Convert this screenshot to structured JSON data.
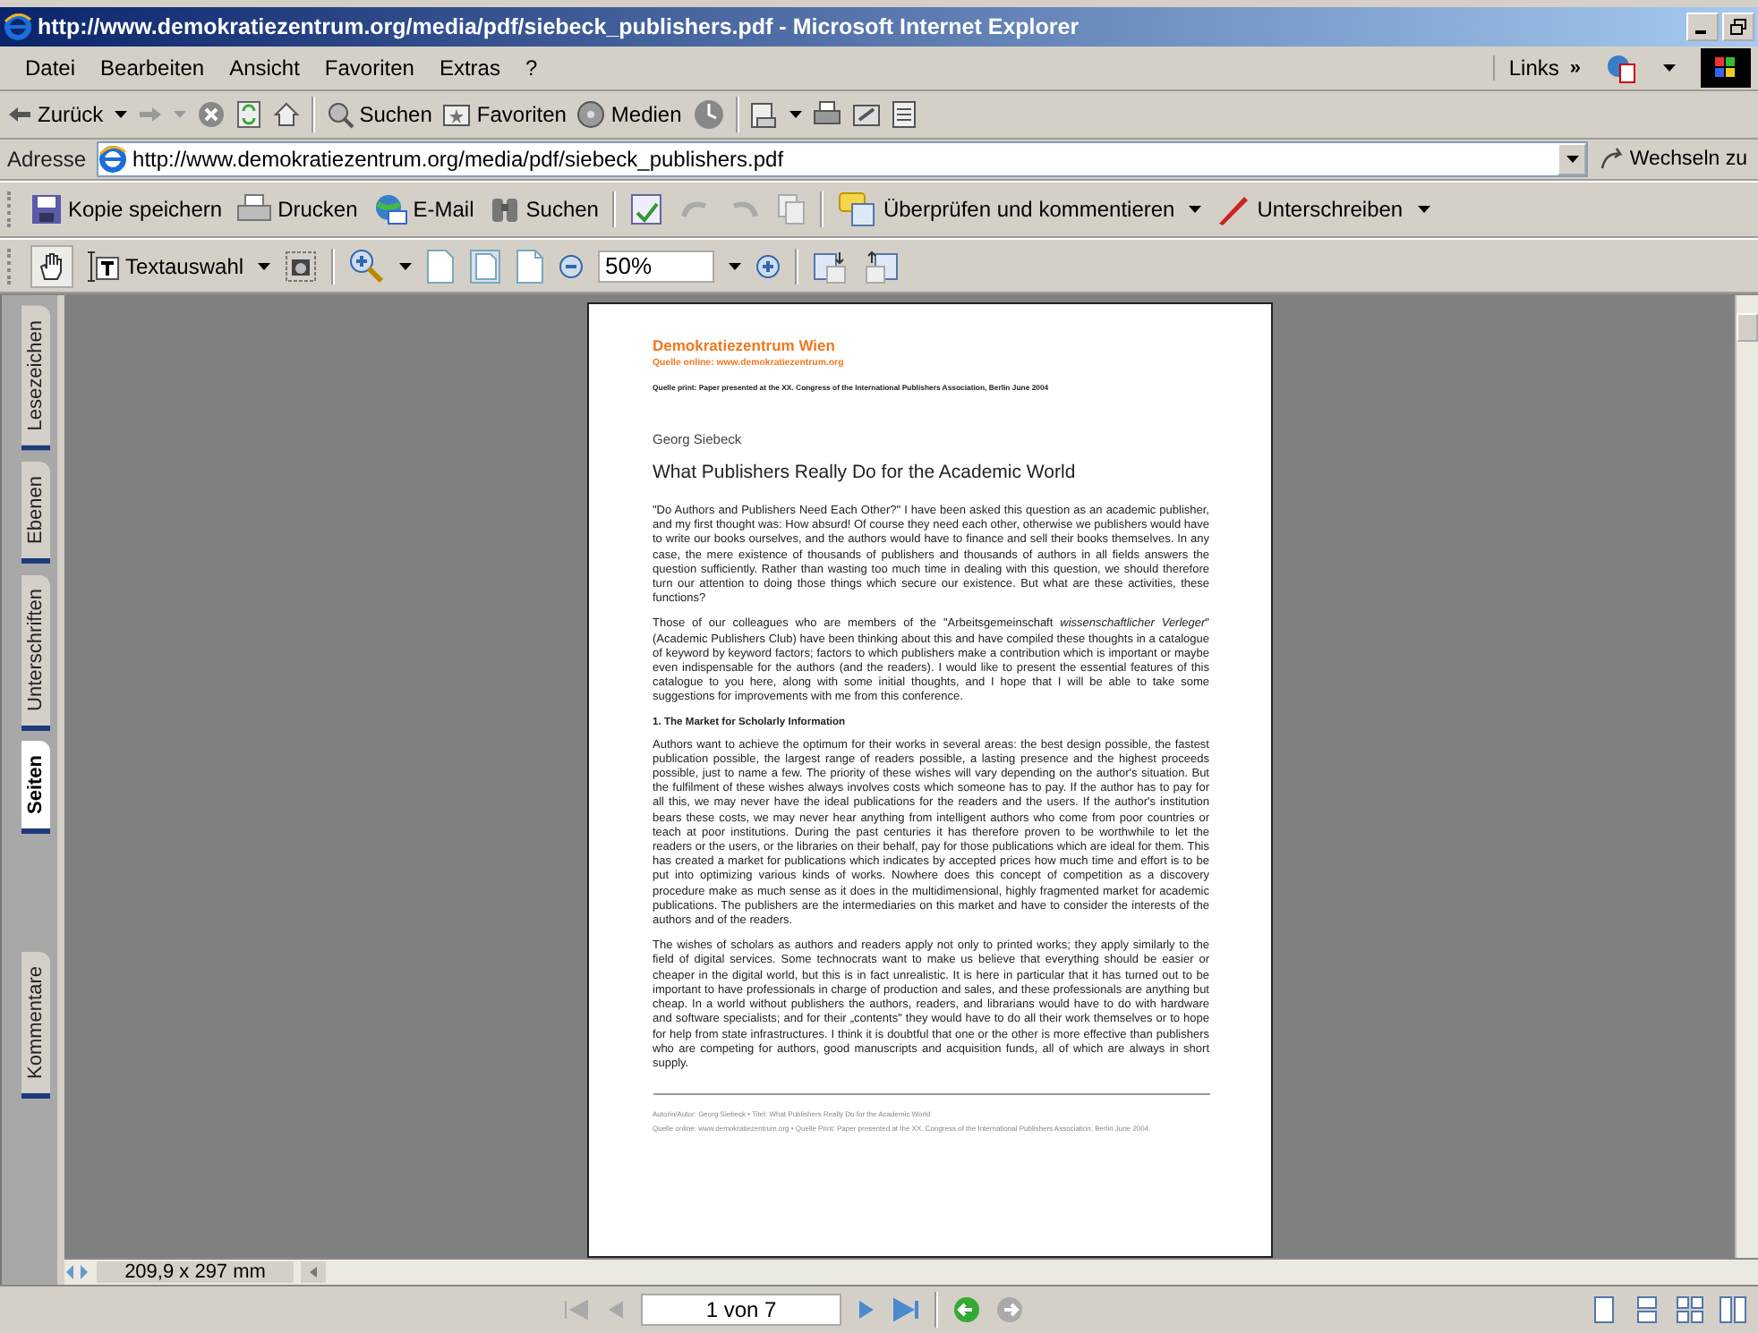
{
  "window": {
    "title": "http://www.demokratiezentrum.org/media/pdf/siebeck_publishers.pdf - Microsoft Internet Explorer"
  },
  "menu": [
    "Datei",
    "Bearbeiten",
    "Ansicht",
    "Favoriten",
    "Extras",
    "?"
  ],
  "links_bar": {
    "label": "Links",
    "chevron": "»"
  },
  "nav_toolbar": {
    "back": "Zurück",
    "search": "Suchen",
    "favorites": "Favoriten",
    "media": "Medien"
  },
  "address_bar": {
    "label": "Adresse",
    "value": "http://www.demokratiezentrum.org/media/pdf/siebeck_publishers.pdf",
    "go": "Wechseln zu"
  },
  "acrobat_toolbar": {
    "save": "Kopie speichern",
    "print": "Drucken",
    "email": "E-Mail",
    "search": "Suchen",
    "review": "Überprüfen und kommentieren",
    "sign": "Unterschreiben"
  },
  "view_toolbar": {
    "select_tool": "Textauswahl",
    "zoom": "50%"
  },
  "side_tabs": [
    {
      "label": "Lesezeichen",
      "selected": false
    },
    {
      "label": "Ebenen",
      "selected": false
    },
    {
      "label": "Unterschriften",
      "selected": false
    },
    {
      "label": "Seiten",
      "selected": true
    },
    {
      "label": "Kommentare",
      "selected": false
    }
  ],
  "document": {
    "org": "Demokratiezentrum Wien",
    "source_online": "Quelle online: www.demokratiezentrum.org",
    "source_print": "Quelle print: Paper presented at the XX. Congress of the International Publishers Association, Berlin June 2004",
    "author": "Georg Siebeck",
    "title": "What Publishers Really Do for the Academic World",
    "paragraphs": [
      {
        "kind": "text",
        "text": "\"Do Authors and Publishers Need Each Other?\" I have been asked this question as an academic publisher, and my first thought was: How absurd! Of course they need each other, otherwise we publishers would have to write our books ourselves, and the authors would have to finance and sell their books themselves. In any case, the mere existence of thousands of publishers and thousands of authors in all fields answers the question sufficiently. Rather than wasting too much time in dealing with this question, we should therefore turn our attention to doing those things which secure our existence. But what are these activities, these functions?"
      },
      {
        "kind": "text",
        "text": "Those of our colleagues who are members of the \"Arbeitsgemeinschaft *wissenschaftlicher Verleger*\" (Academic Publishers Club) have been thinking about this and have compiled these thoughts in a catalogue of keyword by keyword factors; factors to which publishers make a contribution which is important or maybe even indispensable for the authors (and the readers). I would like to present the essential features of this catalogue to you here, along with some initial thoughts, and I hope that I will be able to take some suggestions for improvements with me from this conference."
      },
      {
        "kind": "heading",
        "text": "1. The Market for Scholarly Information"
      },
      {
        "kind": "text",
        "text": "Authors want to achieve the optimum for their works in several areas: the best design possible, the fastest publication possible, the largest range of readers possible, a lasting presence and the highest proceeds possible, just to name a few. The priority of these wishes will vary depending on the author's situation. But the fulfilment of these wishes always involves costs which someone has to pay. If the author has to pay for all this, we may never have the ideal publications for the readers and the users. If the author's institution bears these costs, we may never hear anything from intelligent authors who come from poor countries or teach at poor institutions. During the past centuries it has therefore proven to be worthwhile to let the readers or the users, or the libraries on their behalf, pay for those publications which are ideal for them. This has created a market for publications which indicates by accepted prices how much time and effort is to be put into optimizing various kinds of works. Nowhere does this concept of competition as a discovery procedure make as much sense as it does in the multidimensional, highly fragmented market for academic publications. The publishers are the intermediaries on this market and have to consider the interests of the authors and of the readers."
      },
      {
        "kind": "text",
        "text": "The wishes of scholars as authors and readers apply not only to printed works; they apply similarly to the field of digital services. Some technocrats want to make us believe that everything should be easier or cheaper in the digital world, but this is in fact unrealistic. It is here in particular that it has turned out to be important to have professionals in charge of production and sales, and these professionals are anything but cheap. In a world without publishers the authors, readers, and librarians would have to do with hardware and software specialists; and for their „contents\" they would have to do all their work themselves or to hope for help from state infrastructures. I think it is doubtful that one or the other is more effective than publishers who are competing for authors, good manuscripts and acquisition funds, all of which are always in short supply."
      }
    ],
    "footer": [
      "Autorin/Autor: Georg Siebeck • Titel: What Publishers Really Do for the Academic World",
      "Quelle online: www.demokratiezentrum.org • Quelle Print: Paper presented at the XX. Congress of the International Publishers Association, Berlin June 2004."
    ]
  },
  "page_size": "209,9 x 297 mm",
  "page_nav": {
    "value": "1 von 7"
  }
}
